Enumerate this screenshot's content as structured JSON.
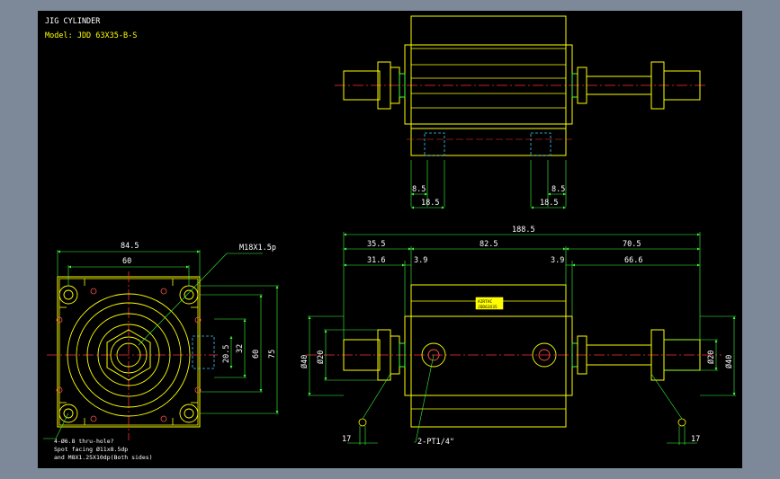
{
  "title_block": {
    "title": "JIG CYLINDER",
    "model": "Model: JDD 63X35-B-S"
  },
  "nameplate": {
    "line1": "AIRTAC",
    "line2": "JDD63X35"
  },
  "front_view": {
    "width_overall": "84.5",
    "mount_pitch": "60",
    "thread_callout": "M18X1.5p",
    "port_height": "20.5",
    "dim_32": "32",
    "dim_60_v": "60",
    "dim_75": "75",
    "hole_note_1": "4-Ø6.8 thru-hole?",
    "hole_note_2": "Spot facing Ø11x8.5dp",
    "hole_note_3": "and M8X1.25X10dp(Both sides)"
  },
  "top_view": {
    "left_85": "8.5",
    "left_185": "18.5",
    "right_85": "8.5",
    "right_185": "18.5"
  },
  "side_view": {
    "overall": "188.5",
    "left_len": "35.5",
    "body_len": "82.5",
    "right_len": "70.5",
    "left_inner": "31.6",
    "step_left": "3.9",
    "step_right": "3.9",
    "right_inner": "66.6",
    "rod_dia_left": "Ø20",
    "boss_dia_left": "Ø40",
    "rod_dia_right": "Ø20",
    "boss_dia_right": "Ø40",
    "port_note": "2-PT1/4\"",
    "flat_left": "17",
    "flat_right": "17"
  }
}
